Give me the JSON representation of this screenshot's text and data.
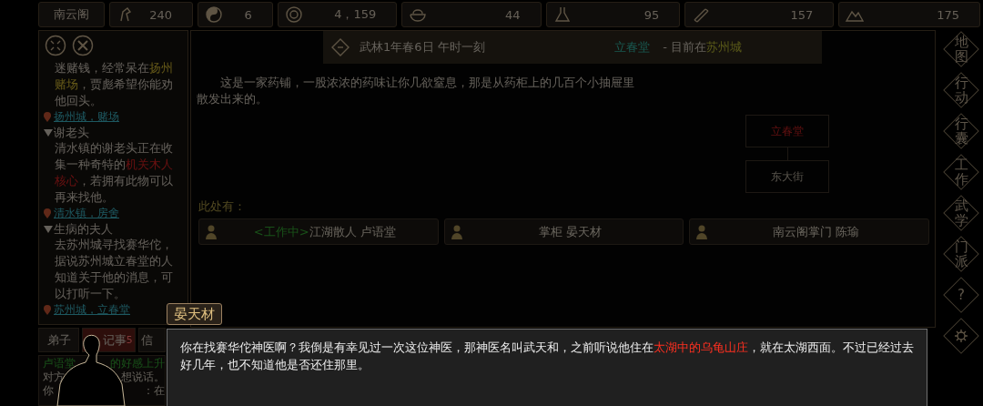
{
  "top_bar": {
    "sect": "南云阁",
    "stats": [
      {
        "value": "240"
      },
      {
        "value": "6"
      },
      {
        "value": "4，159"
      },
      {
        "value": "44"
      },
      {
        "value": "95"
      },
      {
        "value": "157"
      },
      {
        "value": "175"
      }
    ]
  },
  "quests": [
    {
      "expanded": true,
      "description": [
        {
          "text": "迷赌钱，经常呆在",
          "kind": "plain"
        },
        {
          "text": "扬州赌场",
          "kind": "place"
        },
        {
          "text": "，贾彪希望你能劝他回头。",
          "kind": "plain"
        }
      ],
      "location": "扬州城，赌场"
    },
    {
      "title": "谢老头",
      "expanded": true,
      "description": [
        {
          "text": "清水镇的谢老头正在收集一种奇特的",
          "kind": "plain"
        },
        {
          "text": "机关木人核心",
          "kind": "item"
        },
        {
          "text": "，若拥有此物可以再来找他。",
          "kind": "plain"
        }
      ],
      "location": "清水镇，房舍"
    },
    {
      "title": "生病的夫人",
      "expanded": true,
      "description": [
        {
          "text": "去苏州城寻找赛华佗，据说苏州城立春堂的人知道关于他的消息，可以打听一下。",
          "kind": "plain"
        }
      ],
      "location": "苏州城，立春堂"
    }
  ],
  "bottom_tabs": [
    {
      "label": "弟子",
      "selected": false
    },
    {
      "label": "记事",
      "count": "5",
      "selected": true
    },
    {
      "label": "信",
      "selected": false
    }
  ],
  "log": [
    [
      {
        "text": "卢语堂",
        "kind": "event"
      },
      {
        "text": "的好感上升",
        "kind": "event"
      }
    ],
    [
      {
        "text": "对方",
        "kind": "plain"
      },
      {
        "text": "想说话。",
        "kind": "plain"
      }
    ],
    [
      {
        "text": "你",
        "kind": "plain"
      },
      {
        "text": "：在",
        "kind": "plain"
      }
    ]
  ],
  "location_header": {
    "date": "武林1年春6日 午时一刻",
    "place": "立春堂",
    "separator": " - 目前在",
    "city": "苏州城"
  },
  "description": "这是一家药铺，一股浓浓的药味让你几欲窒息，那是从药柜上的几百个小抽屉里散发出来的。",
  "map": [
    {
      "label": "立春堂",
      "current": true
    },
    {
      "label": "东大街",
      "current": false
    }
  ],
  "here_label": "此处有：",
  "npcs": [
    {
      "status": "<工作中>",
      "name": "江湖散人 卢语堂"
    },
    {
      "name": "掌柜 晏天材"
    },
    {
      "name": "南云阁掌门 陈瑜"
    }
  ],
  "side_menu": [
    {
      "kind": "text",
      "label": "地图"
    },
    {
      "kind": "text",
      "label": "行动"
    },
    {
      "kind": "text",
      "label": "行囊"
    },
    {
      "kind": "text",
      "label": "工作"
    },
    {
      "kind": "text",
      "label": "武学"
    },
    {
      "kind": "text",
      "label": "门派"
    },
    {
      "kind": "text",
      "label": "?"
    },
    {
      "kind": "gear"
    }
  ],
  "dialog": {
    "speaker": "晏天材",
    "text": [
      {
        "text": "你在找赛华佗神医啊？我倒是有幸见过一次这位神医，那神医名叫武天和，之前听说他住在",
        "kind": "plain"
      },
      {
        "text": "太湖中的乌龟山庄",
        "kind": "place"
      },
      {
        "text": "，就在太湖西面。不过已经过去好几年，也不知道他是否还住那里。",
        "kind": "plain"
      }
    ]
  }
}
